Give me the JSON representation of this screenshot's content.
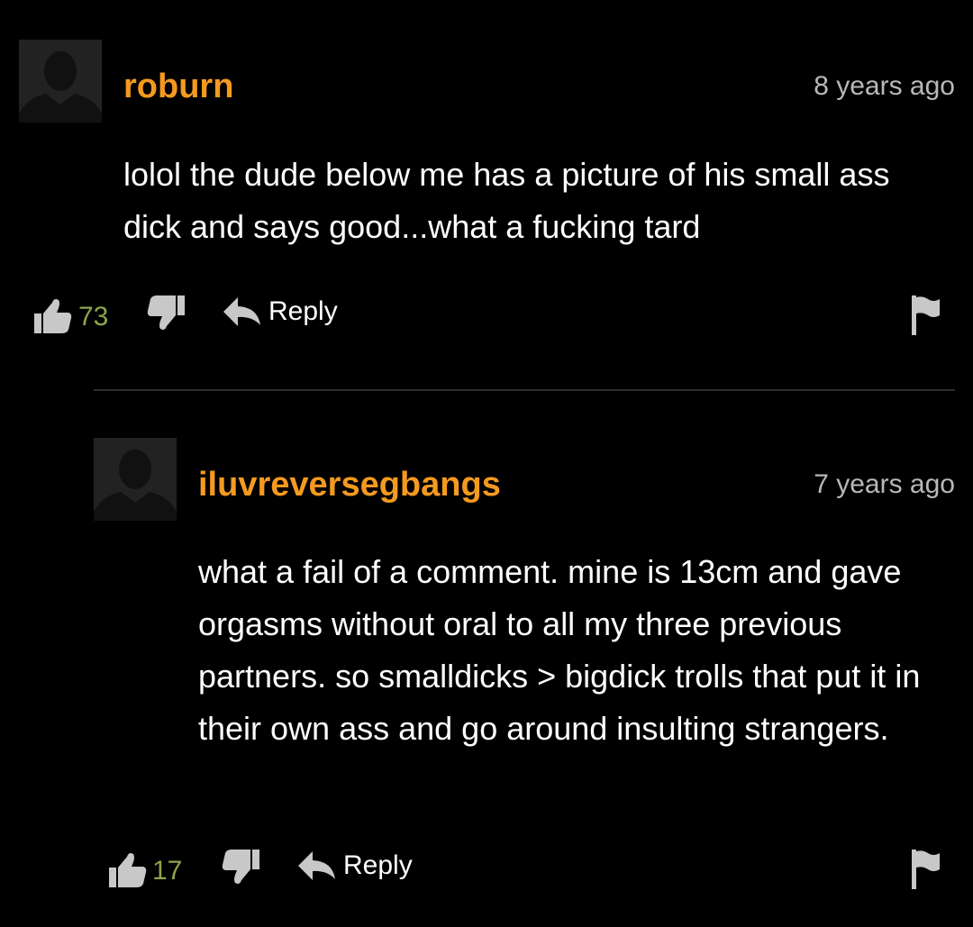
{
  "comments": [
    {
      "username": "roburn",
      "timestamp": "8 years ago",
      "text": "lolol the dude below me has a picture of his small ass dick and says good...what a fucking tard",
      "votes": "73",
      "reply_label": "Reply"
    },
    {
      "username": "iluvreversegbangs",
      "timestamp": "7 years ago",
      "text": "what a fail of a comment. mine is 13cm and gave orgasms without oral to all my three previous partners. so smalldicks > bigdick trolls that put it in their own ass and go around insulting strangers.",
      "votes": "17",
      "reply_label": "Reply"
    }
  ],
  "colors": {
    "background": "#000000",
    "username": "#f49a1f",
    "timestamp": "#b8b8b8",
    "vote_count": "#8ea44d",
    "icon": "#c8c8c8"
  }
}
